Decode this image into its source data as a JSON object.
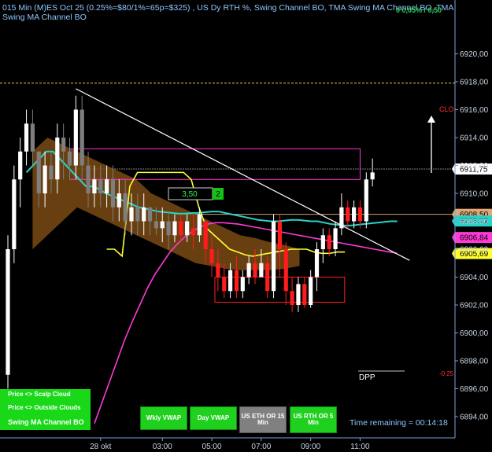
{
  "header": {
    "line1": "015 Min (M)ES Oct 25 (0.25%=$80/1%=65p=$325) , US Dy RTH %, Swing Channel BO, TMA Swing MA Channel BO, TMA",
    "line2": "Swing MA Channel BO",
    "right_readout": "0 0,05% / 0,50"
  },
  "chart_data": {
    "type": "candlestick",
    "ylim": [
      6893.5,
      6921
    ],
    "y_ticks": [
      6894,
      6896,
      6898,
      6900,
      6902,
      6904,
      6906,
      6908,
      6910,
      6912,
      6914,
      6916,
      6918,
      6920
    ],
    "y_tick_labels": [
      "6894,00",
      "6896,00",
      "6898,00",
      "6900,00",
      "6902,00",
      "6904,00",
      "6906,00",
      "6908,00",
      "6910,00",
      "6912,00",
      "6914,00",
      "6916,00",
      "6918,00",
      "6920,00"
    ],
    "x_tick_labels": [
      {
        "label": "28 okt",
        "bar": 15
      },
      {
        "label": "03:00",
        "bar": 25
      },
      {
        "label": "05:00",
        "bar": 33
      },
      {
        "label": "07:00",
        "bar": 41
      },
      {
        "label": "09:00",
        "bar": 49
      },
      {
        "label": "11:00",
        "bar": 57
      }
    ],
    "candles": [
      [
        6897,
        6906,
        6896,
        6907
      ],
      [
        6906,
        6911,
        6905,
        6912
      ],
      [
        6911,
        6913,
        6909,
        6914
      ],
      [
        6913,
        6915,
        6912,
        6916
      ],
      [
        6915,
        6913,
        6912,
        6916
      ],
      [
        6913,
        6910,
        6909,
        6913
      ],
      [
        6910,
        6912,
        6909,
        6913
      ],
      [
        6912,
        6911,
        6910,
        6913
      ],
      [
        6911,
        6914,
        6910,
        6915
      ],
      [
        6914,
        6913,
        6911,
        6915
      ],
      [
        6913,
        6912,
        6911,
        6914
      ],
      [
        6912,
        6916,
        6911,
        6917
      ],
      [
        6916,
        6912,
        6911,
        6917
      ],
      [
        6912,
        6910,
        6909,
        6913
      ],
      [
        6910,
        6911,
        6909,
        6912
      ],
      [
        6911,
        6910,
        6909,
        6912
      ],
      [
        6910,
        6911,
        6909,
        6912
      ],
      [
        6911,
        6909,
        6908,
        6912
      ],
      [
        6909,
        6910,
        6908,
        6911
      ],
      [
        6910,
        6908,
        6907,
        6911
      ],
      [
        6908,
        6909,
        6907,
        6910
      ],
      [
        6909,
        6908,
        6907,
        6910
      ],
      [
        6908,
        6909,
        6907,
        6910
      ],
      [
        6909,
        6908,
        6907,
        6909
      ],
      [
        6908,
        6907.5,
        6907,
        6909
      ],
      [
        6907.5,
        6908,
        6906.5,
        6909
      ],
      [
        6908,
        6907,
        6906,
        6908.5
      ],
      [
        6907,
        6908,
        6906.5,
        6908.5
      ],
      [
        6908,
        6907,
        6906.5,
        6908.5
      ],
      [
        6907,
        6908,
        6906.5,
        6908.5
      ],
      [
        6907.5,
        6907,
        6906,
        6908.5
      ],
      [
        6907,
        6908.5,
        6906.5,
        6909
      ],
      [
        6908,
        6906,
        6905,
        6908
      ],
      [
        6906,
        6905,
        6904,
        6907
      ],
      [
        6905,
        6904,
        6903,
        6906
      ],
      [
        6904,
        6903,
        6902.5,
        6905
      ],
      [
        6903,
        6904.5,
        6902.5,
        6905
      ],
      [
        6904.5,
        6903,
        6902.5,
        6905.5
      ],
      [
        6903,
        6904,
        6902.5,
        6904.5
      ],
      [
        6904,
        6905,
        6903.5,
        6905.5
      ],
      [
        6905,
        6904,
        6903.5,
        6906
      ],
      [
        6904,
        6905,
        6904,
        6906
      ],
      [
        6905,
        6903,
        6902.5,
        6905.5
      ],
      [
        6903,
        6908,
        6902.5,
        6908.5
      ],
      [
        6908,
        6906,
        6904,
        6908.5
      ],
      [
        6906,
        6903,
        6902,
        6906.5
      ],
      [
        6903,
        6902,
        6901.5,
        6904
      ],
      [
        6902,
        6903.5,
        6901.5,
        6904
      ],
      [
        6903.5,
        6902,
        6901.8,
        6904
      ],
      [
        6902,
        6904,
        6901.8,
        6904.5
      ],
      [
        6904,
        6906,
        6903,
        6906.5
      ],
      [
        6906,
        6907,
        6905,
        6907.5
      ],
      [
        6907,
        6906,
        6905.5,
        6907.5
      ],
      [
        6906,
        6907.5,
        6905.5,
        6908
      ],
      [
        6907.5,
        6909,
        6907,
        6910
      ],
      [
        6909,
        6908,
        6907.5,
        6909.5
      ],
      [
        6908,
        6909,
        6907.5,
        6909.5
      ],
      [
        6909,
        6908,
        6907.5,
        6909.5
      ],
      [
        6908,
        6911,
        6907.5,
        6911.5
      ],
      [
        6911,
        6911.5,
        6910.5,
        6912.5
      ]
    ],
    "series": [
      {
        "name": "",
        "color": "#27d3c9",
        "values": [
          6911.5,
          6912,
          6912.5,
          6913,
          6913,
          6912.5,
          6912,
          6911.5,
          6911,
          6910.5,
          6910.5,
          6910.3,
          6910,
          6909.8,
          6909.6,
          6909.4,
          6909.2,
          6909,
          6908.9,
          6908.8,
          6908.7,
          6908.65,
          6908.6,
          6908.55,
          6908.55,
          6908.6,
          6908.6,
          6908.65,
          6908.7,
          6908.7,
          6908.6,
          6908.5,
          6908.4,
          6908.3,
          6908.2,
          6908.1,
          6908.05,
          6908,
          6908,
          6908.05,
          6908.1,
          6908.1,
          6908.05,
          6908,
          6908,
          6907.9,
          6907.8,
          6907.75,
          6907.7,
          6907.7,
          6907.75,
          6907.8,
          6907.85,
          6907.9,
          6907.95,
          6908,
          6908
        ]
      },
      {
        "name": "",
        "color": "#ff3ad6",
        "values": [
          6893.5,
          6895,
          6896.5,
          6898,
          6899.5,
          6900.8,
          6902,
          6903.2,
          6904.2,
          6905,
          6905.8,
          6906.4,
          6906.9,
          6907.3,
          6907.6,
          6907.8,
          6907.9,
          6907.9,
          6907.85,
          6907.8,
          6907.7,
          6907.6,
          6907.5,
          6907.4,
          6907.3,
          6907.2,
          6907.1,
          6907,
          6906.9,
          6906.8,
          6906.7,
          6906.6,
          6906.5,
          6906.4,
          6906.3,
          6906.2,
          6906.1,
          6906,
          6905.9,
          6905.8,
          6905.7
        ]
      },
      {
        "name": "",
        "color": "#ffff33",
        "values": [
          6906,
          6906,
          6905.5,
          6910.5,
          6911.5,
          6911.5,
          6911.5,
          6911.5,
          6911.5,
          6911.5,
          6911.5,
          6911,
          6909,
          6907.5,
          6907,
          6906.5,
          6906,
          6905.8,
          6905.6,
          6905.5,
          6905.6,
          6905.7,
          6905.8,
          6905.9,
          6906,
          6906,
          6906,
          6905.8,
          6905.7,
          6905.7,
          6905.8,
          6905.8
        ]
      }
    ],
    "price_labels": [
      {
        "text": "6911,75",
        "price": 6911.75,
        "bg": "#ffffff",
        "fg": "#000000"
      },
      {
        "text": "6908,50",
        "price": 6908.5,
        "bg": "#e0a878",
        "fg": "#000000"
      },
      {
        "text": "6908,02",
        "price": 6908.02,
        "bg": "#27d3c9",
        "fg": "#000000"
      },
      {
        "text": "6906,84",
        "price": 6906.84,
        "bg": "#ff3ad6",
        "fg": "#000000"
      },
      {
        "text": "6905,69",
        "price": 6905.69,
        "bg": "#ffff33",
        "fg": "#000000"
      }
    ],
    "annotations": {
      "clo": "CLO",
      "dpp": "DPP",
      "minus_label": "-0.25",
      "target_label": "3,50",
      "target_count": "2"
    },
    "levels": {
      "magenta_upper": 6913.2,
      "magenta_lower": 6911.0,
      "yellow_dashed": 6917.9,
      "white_dotted": 6911.75,
      "tan_level": 6908.5
    },
    "colors": {
      "up": "#ffffff",
      "down": "#ff1c1c",
      "down_early": "#7e7e7e",
      "cloud": "#7a4a14",
      "axis": "#7ea0d8",
      "grid_text": "#8ec7ff"
    }
  },
  "buttons": {
    "price_scalp_cloud": "Price <> Scalp Cloud",
    "price_outside_clouds": "Price <> Outside Clouds",
    "swing_ma_channel": "Swing MA Channel BO",
    "wkly_vwap": "Wkly VWAP",
    "day_vwap": "Day VWAP",
    "us_eth_or_15": "US ETH OR 15 Min",
    "us_rth_or_5": "US RTH OR 5 Min"
  },
  "time_remaining": "Time remaining = 00:14:18"
}
